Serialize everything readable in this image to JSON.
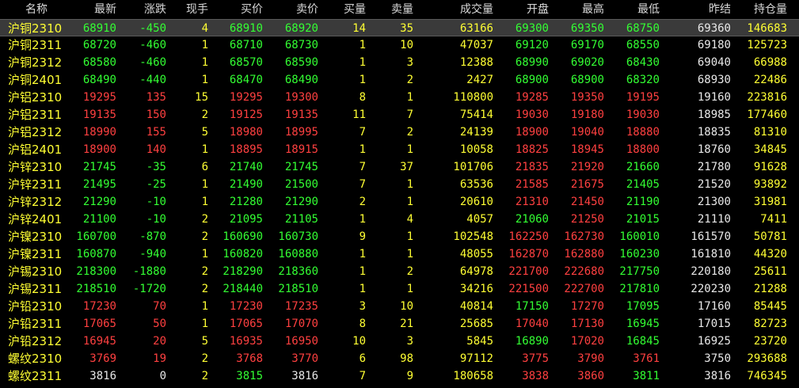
{
  "headers": [
    "名称",
    "最新",
    "涨跌",
    "现手",
    "买价",
    "卖价",
    "买量",
    "卖量",
    "成交量",
    "开盘",
    "最高",
    "最低",
    "昨结",
    "持仓量"
  ],
  "colors": {
    "up": "#ff4040",
    "down": "#33ff33",
    "flat": "#e8e8e8",
    "yellow": "#ffff33",
    "selected_row_bg": "#3a3a3a"
  },
  "rows": [
    {
      "name": "沪铜2310",
      "last": "68910",
      "chg": "-450",
      "vol_now": "4",
      "bid": "68910",
      "ask": "68920",
      "bid_vol": "14",
      "ask_vol": "35",
      "volume": "63166",
      "open": "69300",
      "high": "69350",
      "low": "68750",
      "prev": "69360",
      "oi": "146683"
    },
    {
      "name": "沪铜2311",
      "last": "68720",
      "chg": "-460",
      "vol_now": "1",
      "bid": "68710",
      "ask": "68730",
      "bid_vol": "1",
      "ask_vol": "10",
      "volume": "47037",
      "open": "69120",
      "high": "69170",
      "low": "68550",
      "prev": "69180",
      "oi": "125723"
    },
    {
      "name": "沪铜2312",
      "last": "68580",
      "chg": "-460",
      "vol_now": "1",
      "bid": "68570",
      "ask": "68590",
      "bid_vol": "1",
      "ask_vol": "3",
      "volume": "12388",
      "open": "68990",
      "high": "69020",
      "low": "68430",
      "prev": "69040",
      "oi": "66988"
    },
    {
      "name": "沪铜2401",
      "last": "68490",
      "chg": "-440",
      "vol_now": "1",
      "bid": "68470",
      "ask": "68490",
      "bid_vol": "1",
      "ask_vol": "2",
      "volume": "2427",
      "open": "68900",
      "high": "68900",
      "low": "68320",
      "prev": "68930",
      "oi": "22486"
    },
    {
      "name": "沪铝2310",
      "last": "19295",
      "chg": "135",
      "vol_now": "15",
      "bid": "19295",
      "ask": "19300",
      "bid_vol": "8",
      "ask_vol": "1",
      "volume": "110800",
      "open": "19285",
      "high": "19350",
      "low": "19195",
      "prev": "19160",
      "oi": "223816"
    },
    {
      "name": "沪铝2311",
      "last": "19135",
      "chg": "150",
      "vol_now": "2",
      "bid": "19125",
      "ask": "19135",
      "bid_vol": "11",
      "ask_vol": "7",
      "volume": "75414",
      "open": "19030",
      "high": "19180",
      "low": "19030",
      "prev": "18985",
      "oi": "177460"
    },
    {
      "name": "沪铝2312",
      "last": "18990",
      "chg": "155",
      "vol_now": "5",
      "bid": "18980",
      "ask": "18995",
      "bid_vol": "7",
      "ask_vol": "2",
      "volume": "24139",
      "open": "18900",
      "high": "19040",
      "low": "18880",
      "prev": "18835",
      "oi": "81310"
    },
    {
      "name": "沪铝2401",
      "last": "18900",
      "chg": "140",
      "vol_now": "1",
      "bid": "18895",
      "ask": "18915",
      "bid_vol": "1",
      "ask_vol": "1",
      "volume": "10058",
      "open": "18825",
      "high": "18945",
      "low": "18800",
      "prev": "18760",
      "oi": "34845"
    },
    {
      "name": "沪锌2310",
      "last": "21745",
      "chg": "-35",
      "vol_now": "6",
      "bid": "21740",
      "ask": "21745",
      "bid_vol": "7",
      "ask_vol": "37",
      "volume": "101706",
      "open": "21835",
      "high": "21920",
      "low": "21660",
      "prev": "21780",
      "oi": "91628"
    },
    {
      "name": "沪锌2311",
      "last": "21495",
      "chg": "-25",
      "vol_now": "1",
      "bid": "21490",
      "ask": "21500",
      "bid_vol": "7",
      "ask_vol": "1",
      "volume": "63536",
      "open": "21585",
      "high": "21675",
      "low": "21405",
      "prev": "21520",
      "oi": "93892"
    },
    {
      "name": "沪锌2312",
      "last": "21290",
      "chg": "-10",
      "vol_now": "1",
      "bid": "21280",
      "ask": "21290",
      "bid_vol": "2",
      "ask_vol": "1",
      "volume": "20610",
      "open": "21310",
      "high": "21450",
      "low": "21190",
      "prev": "21300",
      "oi": "31981"
    },
    {
      "name": "沪锌2401",
      "last": "21100",
      "chg": "-10",
      "vol_now": "2",
      "bid": "21095",
      "ask": "21105",
      "bid_vol": "1",
      "ask_vol": "4",
      "volume": "4057",
      "open": "21060",
      "high": "21250",
      "low": "21015",
      "prev": "21110",
      "oi": "7411"
    },
    {
      "name": "沪镍2310",
      "last": "160700",
      "chg": "-870",
      "vol_now": "2",
      "bid": "160690",
      "ask": "160730",
      "bid_vol": "9",
      "ask_vol": "1",
      "volume": "102548",
      "open": "162250",
      "high": "162730",
      "low": "160010",
      "prev": "161570",
      "oi": "50781"
    },
    {
      "name": "沪镍2311",
      "last": "160870",
      "chg": "-940",
      "vol_now": "1",
      "bid": "160820",
      "ask": "160880",
      "bid_vol": "1",
      "ask_vol": "1",
      "volume": "48055",
      "open": "162870",
      "high": "162880",
      "low": "160230",
      "prev": "161810",
      "oi": "44320"
    },
    {
      "name": "沪锡2310",
      "last": "218300",
      "chg": "-1880",
      "vol_now": "2",
      "bid": "218290",
      "ask": "218360",
      "bid_vol": "1",
      "ask_vol": "2",
      "volume": "64978",
      "open": "221700",
      "high": "222680",
      "low": "217750",
      "prev": "220180",
      "oi": "25611"
    },
    {
      "name": "沪锡2311",
      "last": "218510",
      "chg": "-1720",
      "vol_now": "2",
      "bid": "218440",
      "ask": "218510",
      "bid_vol": "1",
      "ask_vol": "1",
      "volume": "34216",
      "open": "221500",
      "high": "222700",
      "low": "217810",
      "prev": "220230",
      "oi": "21288"
    },
    {
      "name": "沪铅2310",
      "last": "17230",
      "chg": "70",
      "vol_now": "1",
      "bid": "17230",
      "ask": "17235",
      "bid_vol": "3",
      "ask_vol": "10",
      "volume": "40814",
      "open": "17150",
      "high": "17270",
      "low": "17095",
      "prev": "17160",
      "oi": "85445"
    },
    {
      "name": "沪铅2311",
      "last": "17065",
      "chg": "50",
      "vol_now": "1",
      "bid": "17065",
      "ask": "17070",
      "bid_vol": "8",
      "ask_vol": "21",
      "volume": "25685",
      "open": "17040",
      "high": "17130",
      "low": "16945",
      "prev": "17015",
      "oi": "82723"
    },
    {
      "name": "沪铅2312",
      "last": "16945",
      "chg": "20",
      "vol_now": "5",
      "bid": "16935",
      "ask": "16950",
      "bid_vol": "10",
      "ask_vol": "3",
      "volume": "5845",
      "open": "16890",
      "high": "17020",
      "low": "16845",
      "prev": "16925",
      "oi": "23720"
    },
    {
      "name": "螺纹2310",
      "last": "3769",
      "chg": "19",
      "vol_now": "2",
      "bid": "3768",
      "ask": "3770",
      "bid_vol": "6",
      "ask_vol": "98",
      "volume": "97112",
      "open": "3775",
      "high": "3790",
      "low": "3761",
      "prev": "3750",
      "oi": "293688"
    },
    {
      "name": "螺纹2311",
      "last": "3816",
      "chg": "0",
      "vol_now": "2",
      "bid": "3815",
      "ask": "3816",
      "bid_vol": "7",
      "ask_vol": "9",
      "volume": "180658",
      "open": "3838",
      "high": "3860",
      "low": "3811",
      "prev": "3816",
      "oi": "746345"
    }
  ]
}
